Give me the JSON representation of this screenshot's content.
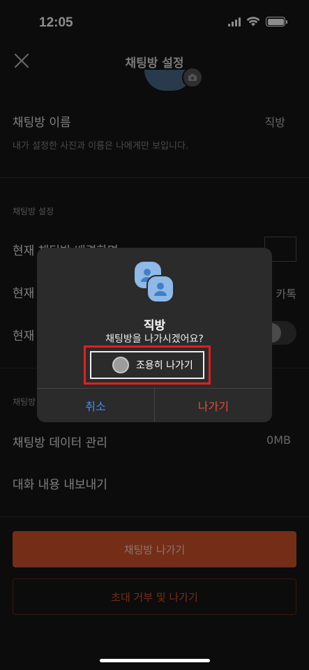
{
  "status": {
    "time": "12:05"
  },
  "header": {
    "title": "채팅방 설정",
    "close_icon": "close-icon"
  },
  "name_row": {
    "title": "채팅방 이름",
    "value": "직방",
    "description": "내가 설정한 사진과 이름은 나에게만 보입니다."
  },
  "settings_section": {
    "label": "채팅방 설정",
    "rows": [
      {
        "title": "현재 채팅방 배경화면"
      },
      {
        "title": "현재",
        "value": "카톡"
      },
      {
        "title": "현재"
      }
    ]
  },
  "data_section": {
    "label": "채팅방",
    "rows": [
      {
        "title": "채팅방 데이터 관리",
        "value": "0MB"
      },
      {
        "title": "대화 내용 내보내기"
      }
    ]
  },
  "buttons": {
    "leave": "채팅방 나가기",
    "block_leave": "초대 거부 및 나가기"
  },
  "dialog": {
    "title": "직방",
    "message": "채팅방을 나가시겠어요?",
    "silent_option": "조용히 나가기",
    "cancel": "취소",
    "confirm": "나가기",
    "colors": {
      "cancel": "#3b8ff5",
      "confirm": "#ef4a3c",
      "highlight": "#e02020"
    }
  }
}
